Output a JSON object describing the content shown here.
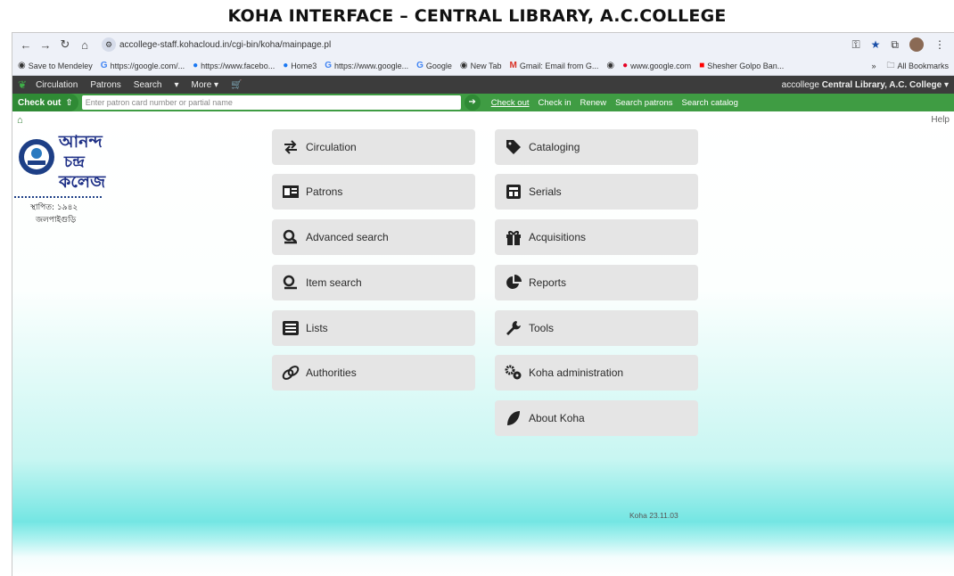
{
  "caption": "KOHA INTERFACE – CENTRAL LIBRARY, A.C.COLLEGE",
  "browser": {
    "url": "accollege-staff.kohacloud.in/cgi-bin/koha/mainpage.pl",
    "bookmarks": [
      {
        "label": "Save to Mendeley",
        "icon": "mendeley-icon"
      },
      {
        "label": "https://google.com/...",
        "icon": "google-icon"
      },
      {
        "label": "https://www.facebo...",
        "icon": "facebook-icon"
      },
      {
        "label": "Home3",
        "icon": "facebook-icon"
      },
      {
        "label": "https://www.google...",
        "icon": "google-icon"
      },
      {
        "label": "Google",
        "icon": "google-icon"
      },
      {
        "label": "New Tab",
        "icon": "globe-icon"
      },
      {
        "label": "Gmail: Email from G...",
        "icon": "gmail-icon"
      },
      {
        "label": "",
        "icon": "globe-icon"
      },
      {
        "label": "www.google.com",
        "icon": "pinterest-icon"
      },
      {
        "label": "Shesher Golpo Ban...",
        "icon": "youtube-icon"
      }
    ],
    "all_bookmarks": "All Bookmarks",
    "overflow": "»"
  },
  "koha_nav": {
    "items": [
      "Circulation",
      "Patrons",
      "Search",
      "▾",
      "More ▾",
      "🛒"
    ],
    "user": "accollege",
    "library": "Central Library, A.C. College",
    "caret": "▾"
  },
  "checkout_bar": {
    "label": "Check out",
    "placeholder": "Enter patron card number or partial name",
    "go": "➔",
    "links": [
      "Check out",
      "Check in",
      "Renew",
      "Search patrons",
      "Search catalog"
    ]
  },
  "help": "Help",
  "logo": {
    "line1": "আনন্দ",
    "line2": "চন্দ্র",
    "line3": "কলেজ",
    "estd": "স্থাপিত: ১৯৪২",
    "place": "জলপাইগুড়ি",
    "seal_text": "ESTD 1942"
  },
  "modules_left": [
    {
      "label": "Circulation",
      "icon": "circulation-icon"
    },
    {
      "label": "Patrons",
      "icon": "patrons-icon"
    },
    {
      "label": "Advanced search",
      "icon": "advanced-search-icon"
    },
    {
      "label": "Item search",
      "icon": "item-search-icon"
    },
    {
      "label": "Lists",
      "icon": "lists-icon"
    },
    {
      "label": "Authorities",
      "icon": "authorities-icon"
    }
  ],
  "modules_right": [
    {
      "label": "Cataloging",
      "icon": "tag-icon"
    },
    {
      "label": "Serials",
      "icon": "serials-icon"
    },
    {
      "label": "Acquisitions",
      "icon": "gift-icon"
    },
    {
      "label": "Reports",
      "icon": "pie-chart-icon"
    },
    {
      "label": "Tools",
      "icon": "wrench-icon"
    },
    {
      "label": "Koha administration",
      "icon": "cogs-icon"
    },
    {
      "label": "About Koha",
      "icon": "koha-leaf-icon"
    }
  ],
  "version": "Koha 23.11.03"
}
